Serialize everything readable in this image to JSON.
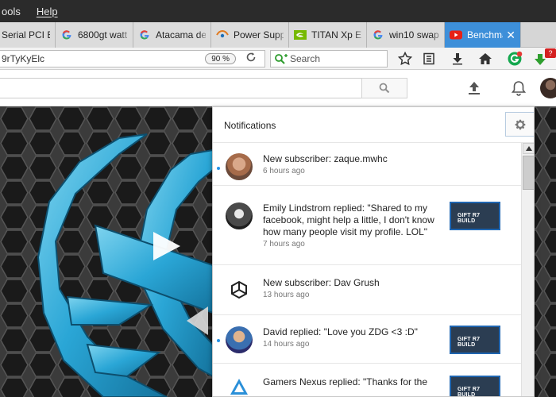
{
  "menubar": {
    "items": [
      {
        "label": "ools"
      },
      {
        "label": "Help"
      }
    ]
  },
  "tabs": [
    {
      "title": "Serial PCI Ex",
      "icon": "none"
    },
    {
      "title": "6800gt watt",
      "icon": "google-g-icon"
    },
    {
      "title": "Atacama de",
      "icon": "google-g-icon"
    },
    {
      "title": "Power Supp",
      "icon": "eye-logo-icon"
    },
    {
      "title": "TITAN Xp En",
      "icon": "nvidia-icon"
    },
    {
      "title": "win10 swap",
      "icon": "google-g-icon"
    },
    {
      "title": "Benchma",
      "icon": "youtube-icon",
      "active": true,
      "close": "✕"
    }
  ],
  "navbar": {
    "url": "9rTyKyElc",
    "zoom": "90 %",
    "search_placeholder": "Search",
    "badge": "?"
  },
  "notifications": {
    "title": "Notifications",
    "items": [
      {
        "text": "New subscriber: zaque.mwhc",
        "time": "6 hours ago",
        "unread": true,
        "thumb": ""
      },
      {
        "text": "Emily Lindstrom replied: \"Shared to my facebook, might help a little, I don't know how many people visit my profile. LOL\"",
        "time": "7 hours ago",
        "unread": false,
        "thumb": "GIFT R7 BUILD"
      },
      {
        "text": "New subscriber: Dav Grush",
        "time": "13 hours ago",
        "unread": false,
        "thumb": ""
      },
      {
        "text": "David replied: \"Love you ZDG <3 :D\"",
        "time": "14 hours ago",
        "unread": true,
        "thumb": "GIFT R7 BUILD"
      },
      {
        "text": "Gamers Nexus replied: \"Thanks for the",
        "time": "",
        "unread": false,
        "thumb": "GIFT R7 BUILD"
      }
    ]
  },
  "colors": {
    "active_tab": "#3d8fd9",
    "unread_dot": "#2793e6",
    "download_arrow": "#2e9e2e",
    "badge_red": "#d42020"
  }
}
